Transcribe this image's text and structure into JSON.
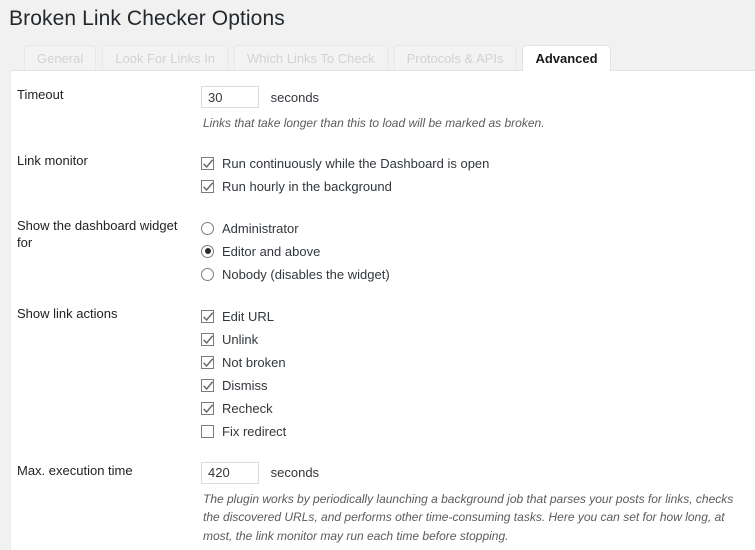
{
  "page": {
    "title": "Broken Link Checker Options"
  },
  "tabs": [
    {
      "label": "General",
      "active": false
    },
    {
      "label": "Look For Links In",
      "active": false
    },
    {
      "label": "Which Links To Check",
      "active": false
    },
    {
      "label": "Protocols & APIs",
      "active": false
    },
    {
      "label": "Advanced",
      "active": true
    }
  ],
  "settings": {
    "timeout": {
      "label": "Timeout",
      "value": "30",
      "placeholder": "",
      "unit": "seconds",
      "description": "Links that take longer than this to load will be marked as broken."
    },
    "link_monitor": {
      "label": "Link monitor",
      "options": [
        {
          "label": "Run continuously while the Dashboard is open",
          "checked": true
        },
        {
          "label": "Run hourly in the background",
          "checked": true
        }
      ]
    },
    "dashboard_widget": {
      "label": "Show the dashboard widget for",
      "options": [
        {
          "label": "Administrator",
          "selected": false
        },
        {
          "label": "Editor and above",
          "selected": true
        },
        {
          "label": "Nobody (disables the widget)",
          "selected": false
        }
      ]
    },
    "link_actions": {
      "label": "Show link actions",
      "options": [
        {
          "label": "Edit URL",
          "checked": true
        },
        {
          "label": "Unlink",
          "checked": true
        },
        {
          "label": "Not broken",
          "checked": true
        },
        {
          "label": "Dismiss",
          "checked": true
        },
        {
          "label": "Recheck",
          "checked": true
        },
        {
          "label": "Fix redirect",
          "checked": false
        }
      ]
    },
    "max_execution_time": {
      "label": "Max. execution time",
      "value": "420",
      "placeholder": "",
      "unit": "seconds",
      "description": "The plugin works by periodically launching a background job that parses your posts for links, checks the discovered URLs, and performs other time-consuming tasks. Here you can set for how long, at most, the link monitor may run each time before stopping."
    }
  },
  "colors": {
    "page_background": "#f1f1f1",
    "panel_background": "#ffffff",
    "text": "#32373c",
    "title": "#23282d",
    "tab_inactive_text": "#d2d2d2",
    "tab_active_text": "#1a1a1a",
    "control_border": "#7c7c7c",
    "radio_dot": "#2b2b2b",
    "description_text": "#5b5b5b"
  }
}
